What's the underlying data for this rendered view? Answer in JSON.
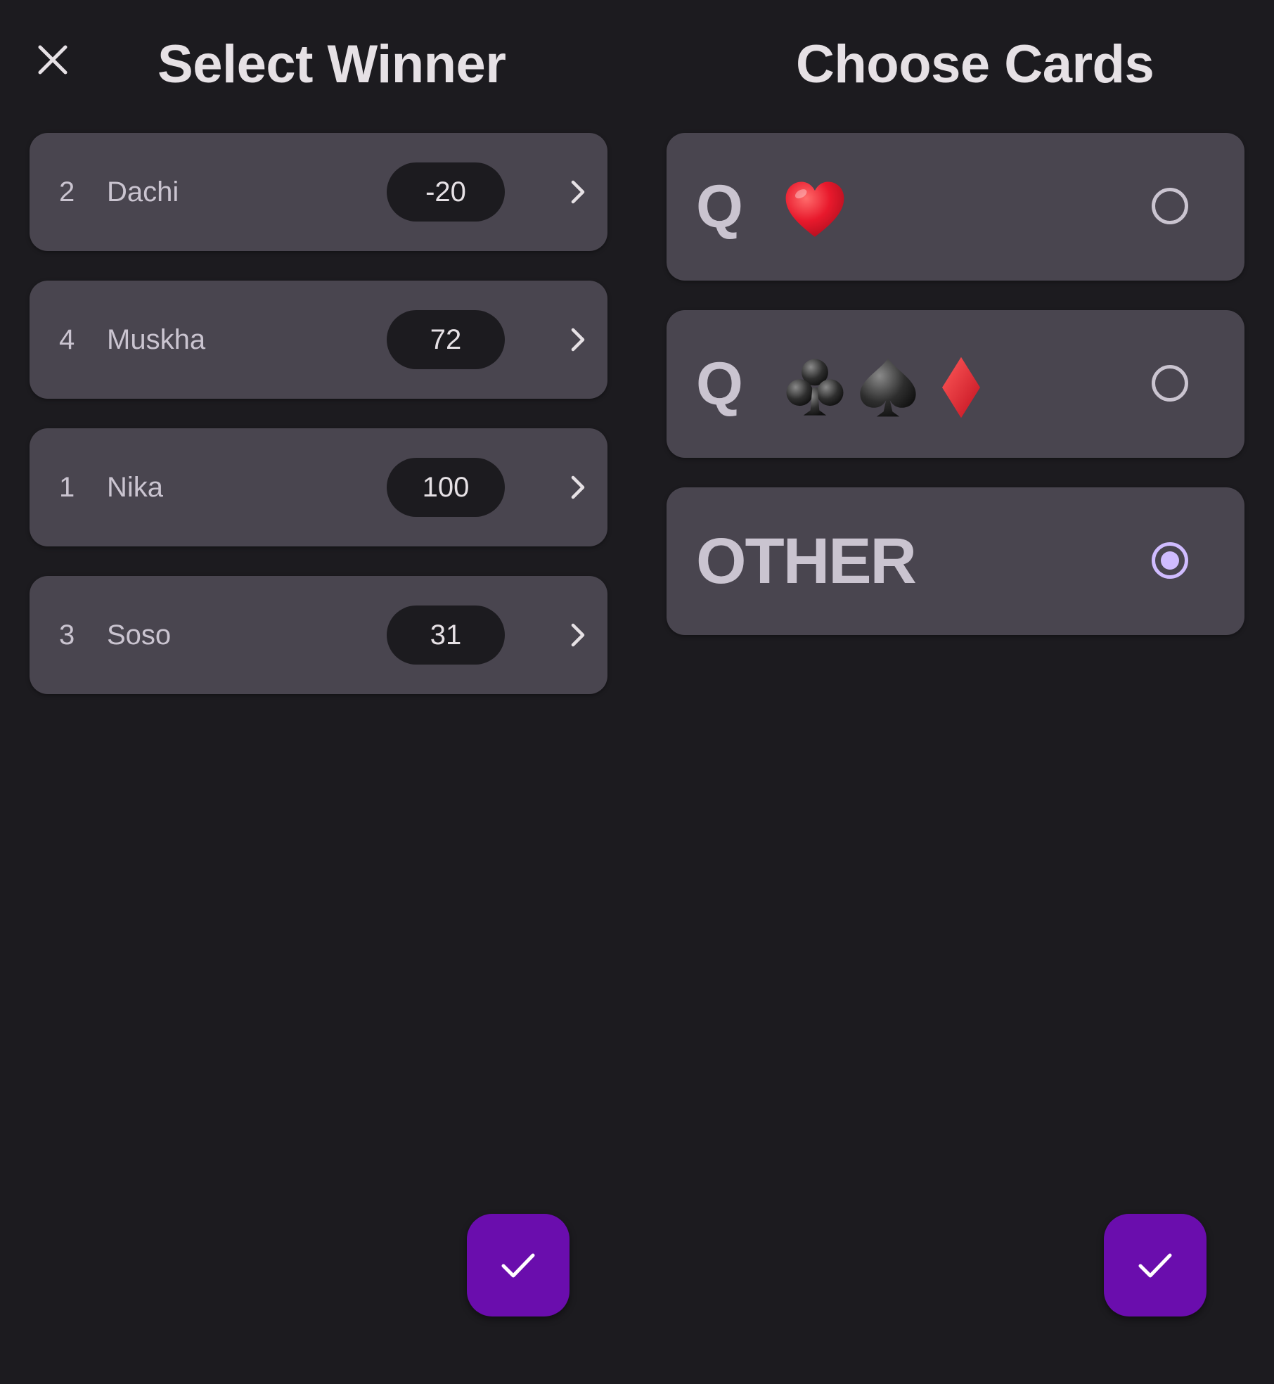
{
  "header": {
    "close_icon": "close-icon",
    "left_title": "Select Winner",
    "right_title": "Choose Cards"
  },
  "players": [
    {
      "rank": "2",
      "name": "Dachi",
      "score": "-20"
    },
    {
      "rank": "4",
      "name": "Muskha",
      "score": "72"
    },
    {
      "rank": "1",
      "name": "Nika",
      "score": "100"
    },
    {
      "rank": "3",
      "name": "Soso",
      "score": "31"
    }
  ],
  "card_options": [
    {
      "rank": "Q",
      "suits": [
        "heart"
      ],
      "selected": false
    },
    {
      "rank": "Q",
      "suits": [
        "club",
        "spade",
        "diamond"
      ],
      "selected": false
    },
    {
      "label": "OTHER",
      "selected": true
    }
  ],
  "colors": {
    "background": "#1c1b1f",
    "row_surface": "#49454f",
    "pill": "#1c1b1f",
    "accent_fab": "#6a0dad",
    "radio_selected": "#d0bcff",
    "text_primary": "#e6e1e5",
    "text_secondary": "#cac4d0"
  },
  "actions": {
    "confirm_winner_icon": "check-icon",
    "confirm_cards_icon": "check-icon"
  }
}
